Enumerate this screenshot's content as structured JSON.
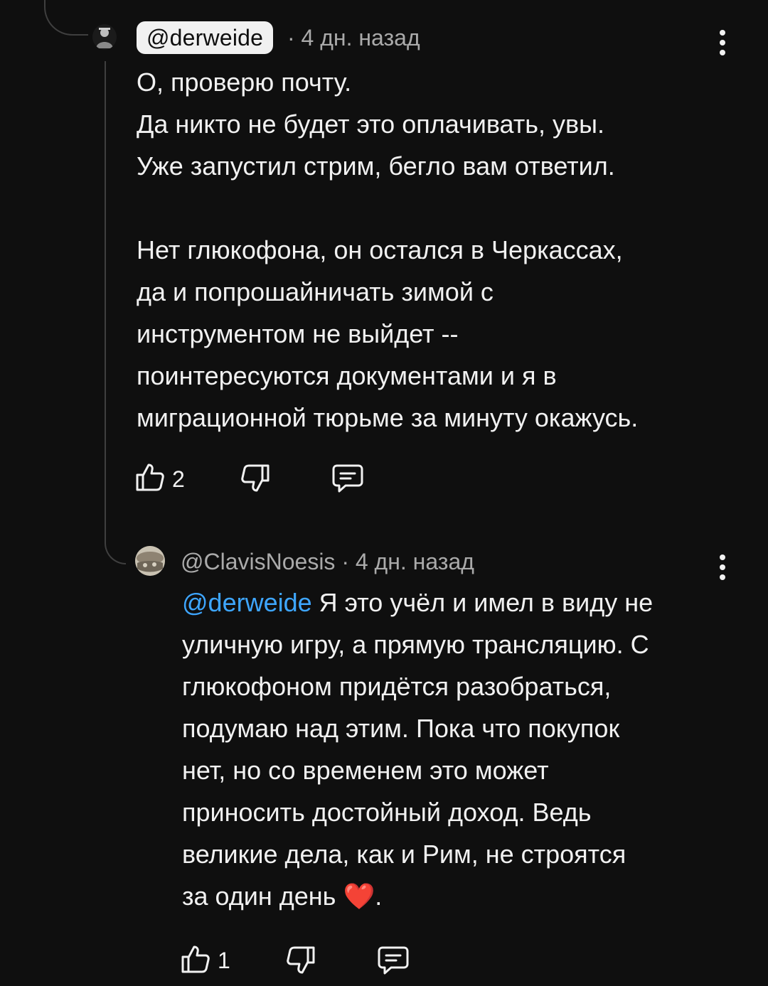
{
  "comments": [
    {
      "author": "@derweide",
      "meta": "· 4 дн. назад",
      "lines": [
        "О, проверю почту.",
        "Да никто не будет это оплачивать, увы.",
        "Уже запустил стрим, бегло вам ответил.",
        "",
        "Нет глюкофона, он остался в Черкассах,",
        "да и попрошайничать зимой с",
        "инструментом не выйдет --",
        "поинтересуются документами и я в",
        "миграционной тюрьме за минуту окажусь."
      ],
      "likes": "2"
    },
    {
      "author_meta": "@ClavisNoesis · 4 дн. назад",
      "mention": "@derweide",
      "line1_rest": " Я это учёл и имел в виду не",
      "lines": [
        "уличную игру, а прямую трансляцию. С",
        "глюкофоном придётся разобраться,",
        "подумаю над этим. Пока что покупок",
        "нет, но со временем это может",
        "приносить достойный доход. Ведь",
        "великие дела, как и Рим, не строятся"
      ],
      "last_line_text": "за один день ",
      "emoji": "❤️",
      "last_line_end": ".",
      "likes": "1"
    }
  ],
  "icons": [
    "like-icon",
    "dislike-icon",
    "reply-icon",
    "more-options-icon"
  ],
  "colors": {
    "background": "#0f0f0f",
    "text": "#f1f1f1",
    "meta": "#aaaaaa",
    "mention": "#3ea6ff"
  }
}
